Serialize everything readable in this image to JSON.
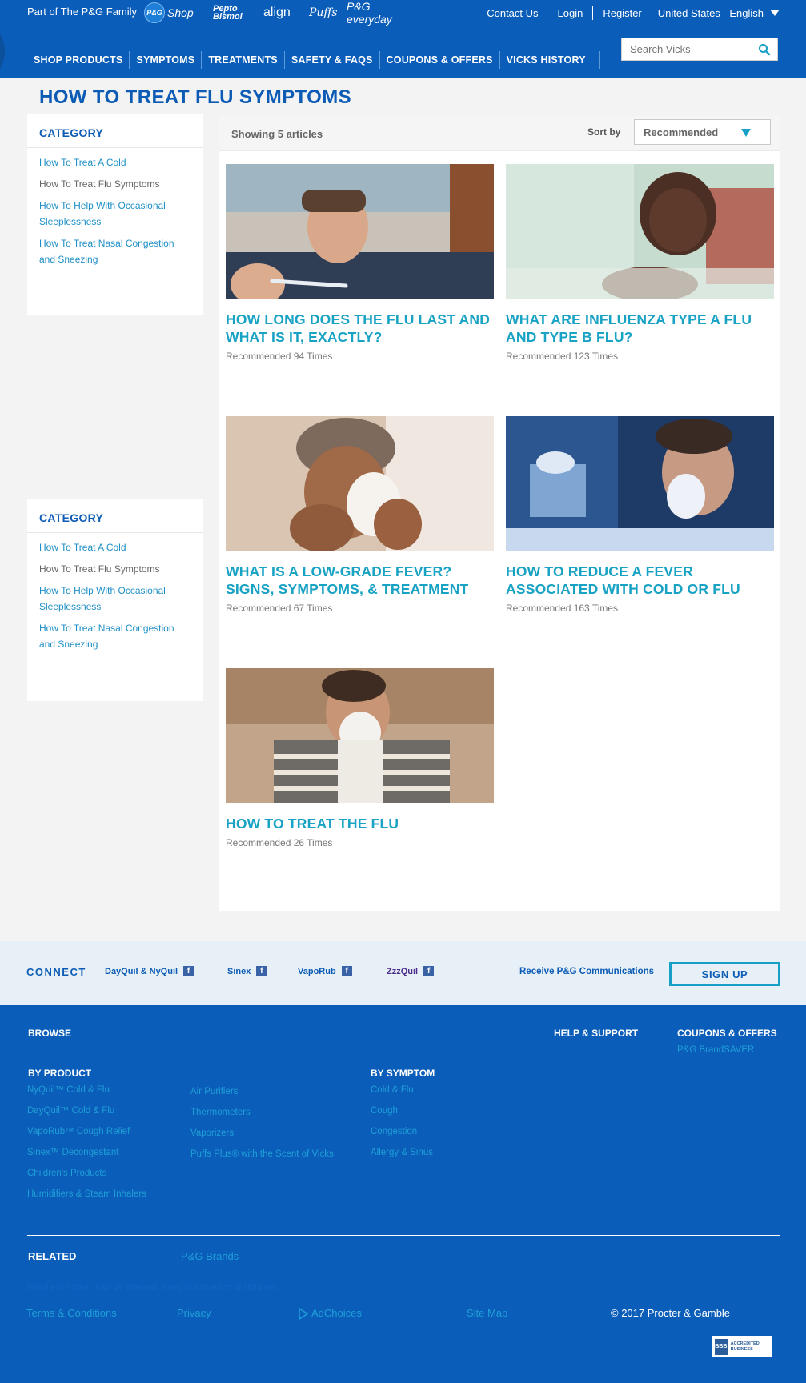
{
  "topbar": {
    "family_label": "Part of The P&G Family",
    "brands": [
      "P&G Shop",
      "Pepto Bismol",
      "align",
      "Puffs",
      "P&G everyday"
    ],
    "pg_shop_disc": "P&G",
    "pg_shop_word": "Shop",
    "contact": "Contact Us",
    "login": "Login",
    "register": "Register",
    "locale": "United States - English"
  },
  "nav": {
    "items": [
      "SHOP PRODUCTS",
      "SYMPTOMS",
      "TREATMENTS",
      "SAFETY & FAQS",
      "COUPONS & OFFERS",
      "VICKS HISTORY"
    ],
    "search_placeholder": "Search Vicks"
  },
  "page": {
    "title": "HOW TO TREAT FLU SYMPTOMS"
  },
  "sidebar": {
    "heading": "CATEGORY",
    "items": [
      {
        "label": "How To Treat A Cold"
      },
      {
        "label": "How To Treat Flu Symptoms"
      },
      {
        "label": "How To Help With Occasional Sleeplessness"
      },
      {
        "label": "How To Treat Nasal Congestion and Sneezing"
      }
    ]
  },
  "listing": {
    "showing": "Showing 5 articles",
    "sort_label": "Sort by",
    "sort_value": "Recommended",
    "articles": [
      {
        "title": "How Long Does the Flu Last and What Is It, Exactly?",
        "meta": "Recommended 94 Times"
      },
      {
        "title": "What Are Influenza Type A Flu and Type B Flu?",
        "meta": "Recommended 123 Times"
      },
      {
        "title": "What Is a Low-Grade Fever? Signs, Symptoms, & Treatment",
        "meta": "Recommended 67 Times"
      },
      {
        "title": "How to Reduce a Fever Associated with Cold or Flu",
        "meta": "Recommended 163 Times"
      },
      {
        "title": "How to Treat the Flu",
        "meta": "Recommended 26 Times"
      }
    ]
  },
  "connect": {
    "label": "CONNECT",
    "social": [
      "DayQuil & NyQuil",
      "Sinex",
      "VapoRub",
      "ZzzQuil"
    ],
    "fb": "f",
    "receive": "Receive P&G Communications",
    "signup": "SIGN UP"
  },
  "footer": {
    "browse": "BROWSE",
    "help_support": "HELP & SUPPORT",
    "coupons": "COUPONS & OFFERS",
    "brandsaver": "P&G BrandSAVER",
    "by_product": "BY PRODUCT",
    "products_col1": [
      "NyQuil™ Cold & Flu",
      "DayQuil™ Cold & Flu",
      "VapoRub™ Cough Relief",
      "Sinex™ Decongestant",
      "Children's Products",
      "Humidifiers & Steam Inhalers"
    ],
    "products_col2": [
      "Air Purifiers",
      "Thermometers",
      "Vaporizers",
      "Puffs Plus® with the Scent of Vicks"
    ],
    "by_symptom": "BY SYMPTOM",
    "symptoms": [
      "Cold & Flu",
      "Cough",
      "Congestion",
      "Allergy & Sinus"
    ],
    "related": "RELATED",
    "pg_brands": "P&G Brands",
    "disclaimer": "Read each label. Use as directed. Keep out of reach of children.",
    "terms": "Terms & Conditions",
    "privacy": "Privacy",
    "adchoices": "AdChoices",
    "sitemap": "Site Map",
    "copyright": "© 2017 Procter & Gamble",
    "bbb_seal": "BBB",
    "bbb_text": "ACCREDITED BUSINESS"
  }
}
